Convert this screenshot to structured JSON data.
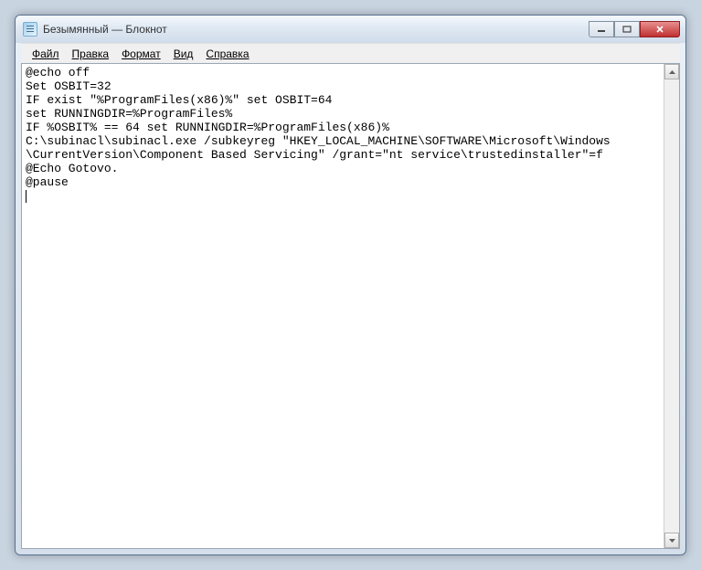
{
  "window": {
    "title": "Безымянный — Блокнот"
  },
  "menu": {
    "file": "Файл",
    "edit": "Правка",
    "format": "Формат",
    "view": "Вид",
    "help": "Справка"
  },
  "content": {
    "line1": "@echo off",
    "line2": "Set OSBIT=32",
    "line3": "IF exist \"%ProgramFiles(x86)%\" set OSBIT=64",
    "line4": "set RUNNINGDIR=%ProgramFiles%",
    "line5": "IF %OSBIT% == 64 set RUNNINGDIR=%ProgramFiles(x86)%",
    "line6": "C:\\subinacl\\subinacl.exe /subkeyreg \"HKEY_LOCAL_MACHINE\\SOFTWARE\\Microsoft\\Windows",
    "line7": "\\CurrentVersion\\Component Based Servicing\" /grant=\"nt service\\trustedinstaller\"=f",
    "line8": "@Echo Gotovo.",
    "line9": "@pause"
  }
}
